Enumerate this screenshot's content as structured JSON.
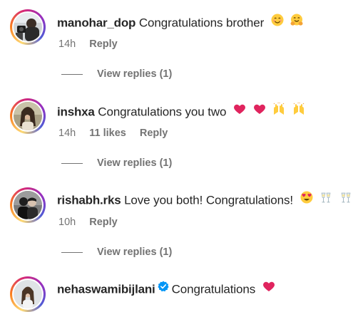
{
  "comments": [
    {
      "username": "manohar_dop",
      "text": "Congratulations brother",
      "time": "14h",
      "likes": "",
      "reply": "Reply",
      "view_replies": "View replies (1)",
      "emojis": [
        "smiling-face-emoji",
        "hugging-face-emoji"
      ]
    },
    {
      "username": "inshxa",
      "text": "Congratulations you two",
      "time": "14h",
      "likes": "11 likes",
      "reply": "Reply",
      "view_replies": "View replies (1)",
      "emojis": [
        "red-heart-emoji",
        "red-heart-emoji",
        "raising-hands-emoji",
        "raising-hands-emoji"
      ]
    },
    {
      "username": "rishabh.rks",
      "text": "Love you both! Congratulations!",
      "time": "10h",
      "likes": "",
      "reply": "Reply",
      "view_replies": "View replies (1)",
      "emojis": [
        "heart-eyes-emoji",
        "clinking-glasses-emoji",
        "clinking-glasses-emoji"
      ]
    },
    {
      "username": "nehaswamibijlani",
      "verified": true,
      "text": "Congratulations",
      "emojis": [
        "red-heart-emoji"
      ]
    }
  ],
  "colors": {
    "text": "#262626",
    "muted": "#737373",
    "verified": "#0095f6",
    "heart": "#e0245e"
  }
}
